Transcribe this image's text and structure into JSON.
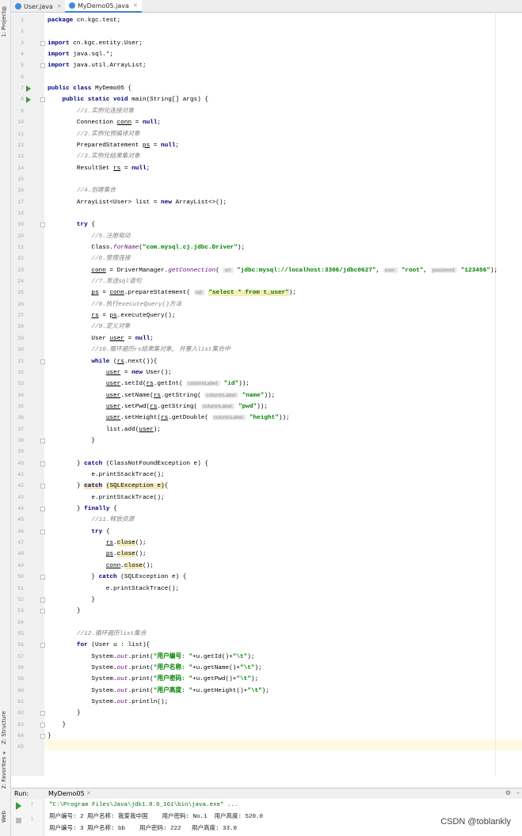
{
  "sidebar": {
    "project": "1: Project",
    "structure": "Z: Structure",
    "favorites": "2: Favorites",
    "web": "Web"
  },
  "tabs": [
    {
      "label": "User.java"
    },
    {
      "label": "MyDemo05.java"
    }
  ],
  "code": [
    "<span class=\"kw\">package</span> cn.kgc.test;",
    "",
    "<span class=\"kw\">import</span> cn.kgc.entity.User;",
    "<span class=\"kw\">import</span> java.sql.*;",
    "<span class=\"kw\">import</span> java.util.ArrayList;",
    "",
    "<span class=\"kw\">public class</span> MyDemo05 {",
    "    <span class=\"kw\">public static void</span> main(String[] args) {",
    "        <span class=\"cm\">//1.实例化连接对象</span>",
    "        Connection <span class=\"ul\">conn</span> = <span class=\"kw\">null</span>;",
    "        <span class=\"cm\">//2.实例化预编译对象</span>",
    "        PreparedStatement <span class=\"ul\">ps</span> = <span class=\"kw\">null</span>;",
    "        <span class=\"cm\">//3.实例化结果集对象</span>",
    "        ResultSet <span class=\"ul\">rs</span> = <span class=\"kw\">null</span>;",
    "",
    "        <span class=\"cm\">//4.创建集合</span>",
    "        ArrayList&lt;User&gt; list = <span class=\"kw\">new</span> ArrayList&lt;&gt;();",
    "",
    "        <span class=\"kw\">try</span> {",
    "            <span class=\"cm\">//5.注册驱动</span>",
    "            Class.<span class=\"fld\">forName</span>(<span class=\"str\">\"com.mysql.cj.jdbc.Driver\"</span>);",
    "            <span class=\"cm\">//6.管理连接</span>",
    "            <span class=\"ul\">conn</span> = DriverManager.<span class=\"fld\">getConnection</span>( <span class=\"hint\">url:</span> <span class=\"str\">\"jdbc:mysql://localhost:3306/jdbc0627\"</span>, <span class=\"hint\">user:</span> <span class=\"str\">\"root\"</span>, <span class=\"hint\">password:</span> <span class=\"str\">\"123456\"</span>);",
    "            <span class=\"cm\">//7.发送sql语句</span>",
    "            <span class=\"ul\">ps</span> = <span class=\"ul\">conn</span>.prepareStatement( <span class=\"hint\">sql:</span> <span class=\"str hl\">\"select * from t_user\"</span>);",
    "            <span class=\"cm\">//8.执行executeQuery()方法</span>",
    "            <span class=\"ul\">rs</span> = <span class=\"ul\">ps</span>.executeQuery();",
    "            <span class=\"cm\">//9.定义对象</span>",
    "            User <span class=\"ul\">user</span> = <span class=\"kw\">null</span>;",
    "            <span class=\"cm\">//10.循环遍历rs结果集对象, 并塞入list集合中</span>",
    "            <span class=\"kw\">while</span> (<span class=\"ul\">rs</span>.next()){",
    "                <span class=\"ul\">user</span> = <span class=\"kw\">new</span> User();",
    "                <span class=\"ul\">user</span>.setId(<span class=\"ul\">rs</span>.getInt( <span class=\"hint\">columnLabel:</span> <span class=\"str\">\"id\"</span>));",
    "                <span class=\"ul\">user</span>.setName(<span class=\"ul\">rs</span>.getString( <span class=\"hint\">columnLabel:</span> <span class=\"str\">\"name\"</span>));",
    "                <span class=\"ul\">user</span>.setPwd(<span class=\"ul\">rs</span>.getString( <span class=\"hint\">columnLabel:</span> <span class=\"str\">\"pwd\"</span>));",
    "                <span class=\"ul\">user</span>.setHeight(<span class=\"ul\">rs</span>.getDouble( <span class=\"hint\">columnLabel:</span> <span class=\"str\">\"height\"</span>));",
    "                list.add(<span class=\"ul\">user</span>);",
    "            }",
    "",
    "        } <span class=\"kw\">catch</span> (ClassNotFoundException e) {",
    "            e.printStackTrace();",
    "        } <span class=\"kw hl\">catch</span> <span class=\"hl\">(SQLException e)</span>{",
    "            e.printStackTrace();",
    "        } <span class=\"kw\">finally</span> {",
    "            <span class=\"cm\">//11.释放资源</span>",
    "            <span class=\"kw\">try</span> {",
    "                <span class=\"ul\">rs</span>.<span class=\"hl\">close</span>();",
    "                <span class=\"ul\">ps</span>.<span class=\"hl\">close</span>();",
    "                <span class=\"ul\">conn</span>.<span class=\"hl\">close</span>();",
    "            } <span class=\"kw\">catch</span> (SQLException e) {",
    "                e.printStackTrace();",
    "            }",
    "        }",
    "",
    "        <span class=\"cm\">//12.循环遍历list集合</span>",
    "        <span class=\"kw\">for</span> (User u : list){",
    "            System.<span class=\"fld\">out</span>.print(<span class=\"str\">\"用户编号: \"</span>+u.getId()+<span class=\"str\">\"\\t\"</span>);",
    "            System.<span class=\"fld\">out</span>.print(<span class=\"str\">\"用户名称: \"</span>+u.getName()+<span class=\"str\">\"\\t\"</span>);",
    "            System.<span class=\"fld\">out</span>.print(<span class=\"str\">\"用户密码: \"</span>+u.getPwd()+<span class=\"str\">\"\\t\"</span>);",
    "            System.<span class=\"fld\">out</span>.print(<span class=\"str\">\"用户高度: \"</span>+u.getHeight()+<span class=\"str\">\"\\t\"</span>);",
    "            System.<span class=\"fld\">out</span>.println();",
    "        }",
    "    }",
    "}",
    ""
  ],
  "run": {
    "label": "Run:",
    "config": "MyDemo05",
    "cmd": "\"C:\\Program Files\\Java\\jdk1.8.0_161\\bin\\java.exe\" ...",
    "lines": [
      "用户编号: 2 用户名称: 我爱我中国    用户密码: No.1  用户高度: 520.0",
      "用户编号: 3 用户名称: bb    用户密码: 222   用户高度: 33.0"
    ]
  },
  "watermark": "CSDN @toblankly"
}
